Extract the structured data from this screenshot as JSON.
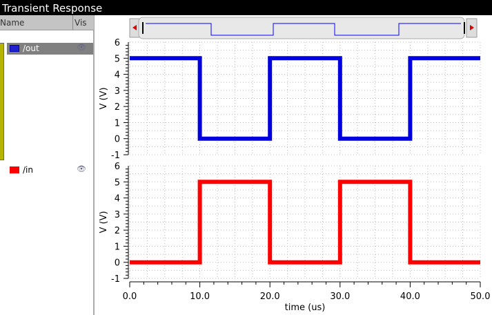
{
  "window": {
    "title": "Transient Response"
  },
  "signal_list": {
    "col_name": "Name",
    "col_vis": "Vis",
    "signals": [
      {
        "name": "/out",
        "color": "#0000dd",
        "selected": true
      },
      {
        "name": "/in",
        "color": "#ff0000",
        "selected": false
      }
    ]
  },
  "chart_data": [
    {
      "type": "line",
      "series": [
        {
          "name": "/out",
          "color": "#0000dd",
          "x": [
            0,
            10,
            10,
            20,
            20,
            30,
            30,
            40,
            40,
            50
          ],
          "y": [
            5,
            5,
            0,
            0,
            5,
            5,
            0,
            0,
            5,
            5
          ]
        }
      ],
      "ylabel": "V (V)",
      "ylim": [
        -1,
        6
      ],
      "yticks": [
        "-1",
        "0",
        "1",
        "2",
        "3",
        "4",
        "5",
        "6"
      ],
      "xlim": [
        0,
        50
      ],
      "grid": true
    },
    {
      "type": "line",
      "series": [
        {
          "name": "/in",
          "color": "#ff0000",
          "x": [
            0,
            10,
            10,
            20,
            20,
            30,
            30,
            40,
            40,
            50
          ],
          "y": [
            0,
            0,
            5,
            5,
            0,
            0,
            5,
            5,
            0,
            0
          ]
        }
      ],
      "ylabel": "V (V)",
      "ylim": [
        -1,
        6
      ],
      "yticks": [
        "-1",
        "0",
        "1",
        "2",
        "3",
        "4",
        "5",
        "6"
      ],
      "xlim": [
        0,
        50
      ],
      "grid": true,
      "xlabel": "time (us)",
      "xticks": [
        "0.0",
        "10.0",
        "20.0",
        "30.0",
        "40.0",
        "50.0"
      ]
    }
  ]
}
